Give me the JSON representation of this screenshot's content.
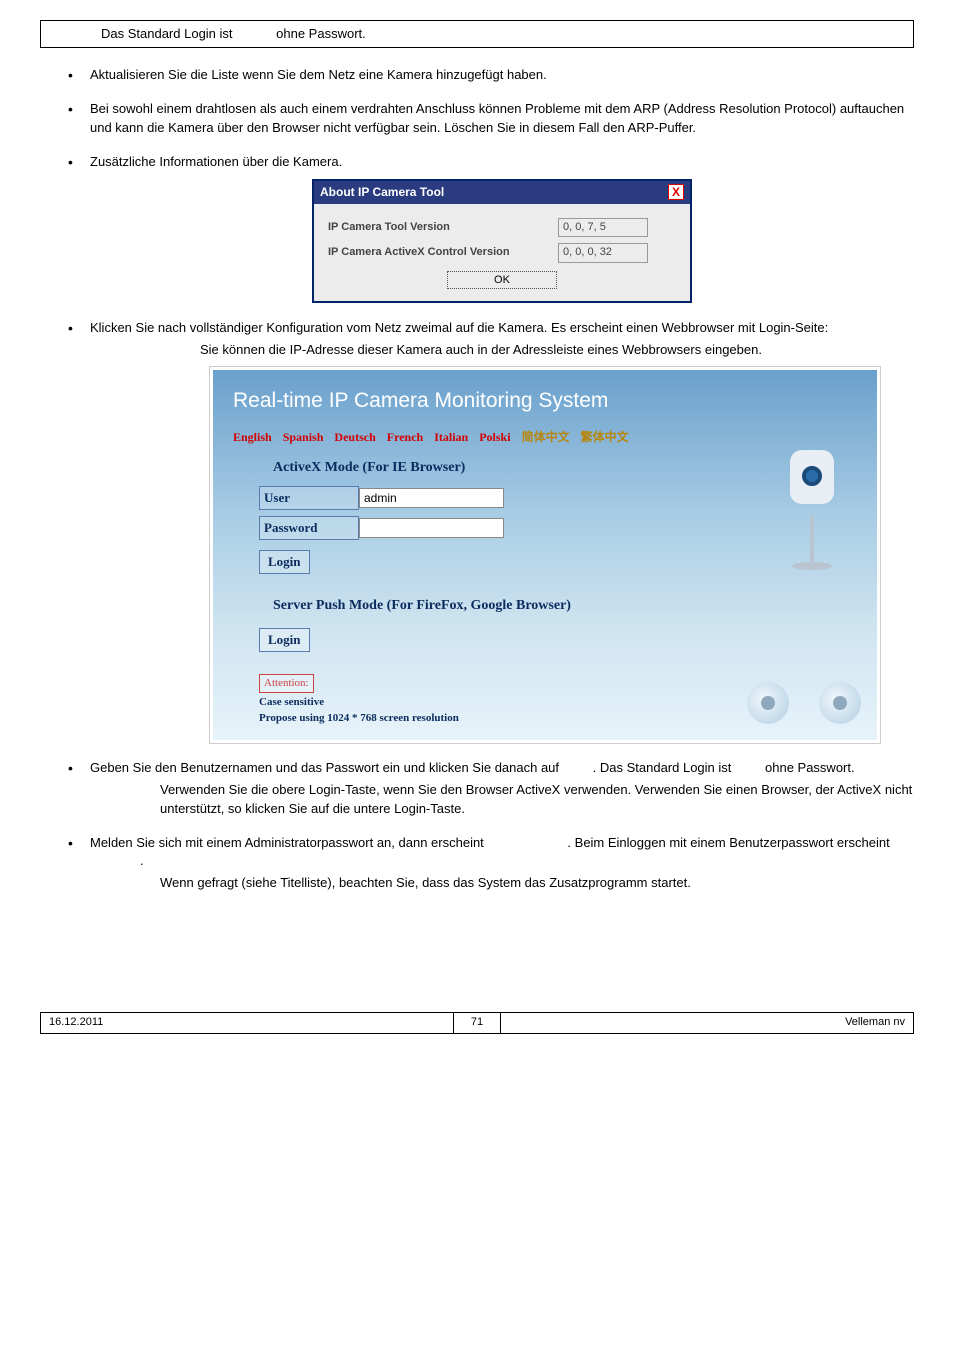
{
  "top_box": {
    "line1_a": "Das Standard Login ist ",
    "line1_b": " ohne Passwort."
  },
  "bullets": {
    "b1": "Aktualisieren Sie die Liste wenn Sie dem Netz eine Kamera hinzugefügt haben.",
    "b2": "Bei sowohl einem drahtlosen als auch einem verdrahten Anschluss können Probleme mit dem ARP (Address Resolution Protocol) auftauchen und kann die Kamera über den Browser nicht verfügbar sein. Löschen Sie in diesem Fall den ARP-Puffer.",
    "b3": "Zusätzliche Informationen über die Kamera.",
    "b4": "Klicken Sie nach vollständiger Konfiguration vom Netz zweimal auf die Kamera. Es erscheint einen Webbrowser mit Login-Seite:",
    "b4_note": "Sie können die IP-Adresse dieser Kamera auch in der Adressleiste eines Webbrowsers eingeben.",
    "b5_a": "Geben Sie den Benutzernamen und das Passwort ein und klicken Sie danach auf ",
    "b5_b": ". Das Standard Login ist ",
    "b5_c": " ohne Passwort.",
    "b5_note": "Verwenden Sie die obere Login-Taste, wenn Sie den Browser ActiveX verwenden. Verwenden Sie einen Browser, der ActiveX nicht unterstützt, so klicken Sie auf die untere Login-Taste.",
    "b6_a": "Melden Sie sich mit einem Administratorpasswort an, dann erscheint ",
    "b6_b": ". Beim Einloggen mit einem Benutzerpasswort erscheint ",
    "b6_c": ".",
    "b6_note": "Wenn gefragt (siehe Titelliste), beachten Sie, dass das System das Zusatzprogramm  startet."
  },
  "dialog": {
    "title": "About IP Camera Tool",
    "row1_label": "IP Camera Tool Version",
    "row1_value": "0, 0, 7, 5",
    "row2_label": "IP Camera ActiveX Control Version",
    "row2_value": "0, 0, 0, 32",
    "ok": "OK"
  },
  "login": {
    "title": "Real-time IP Camera Monitoring System",
    "langs": [
      "English",
      "Spanish",
      "Deutsch",
      "French",
      "Italian",
      "Polski"
    ],
    "langs_cn": [
      "简体中文",
      "繁体中文"
    ],
    "mode1": "ActiveX Mode (For IE Browser)",
    "user_label": "User",
    "user_value": "admin",
    "pass_label": "Password",
    "login_btn": "Login",
    "mode2": "Server Push Mode (For FireFox, Google Browser)",
    "attention": "Attention:",
    "att1": "Case sensitive",
    "att2": "Propose using 1024 * 768 screen resolution"
  },
  "footer": {
    "date": "16.12.2011",
    "page": "71",
    "company": "Velleman nv"
  }
}
